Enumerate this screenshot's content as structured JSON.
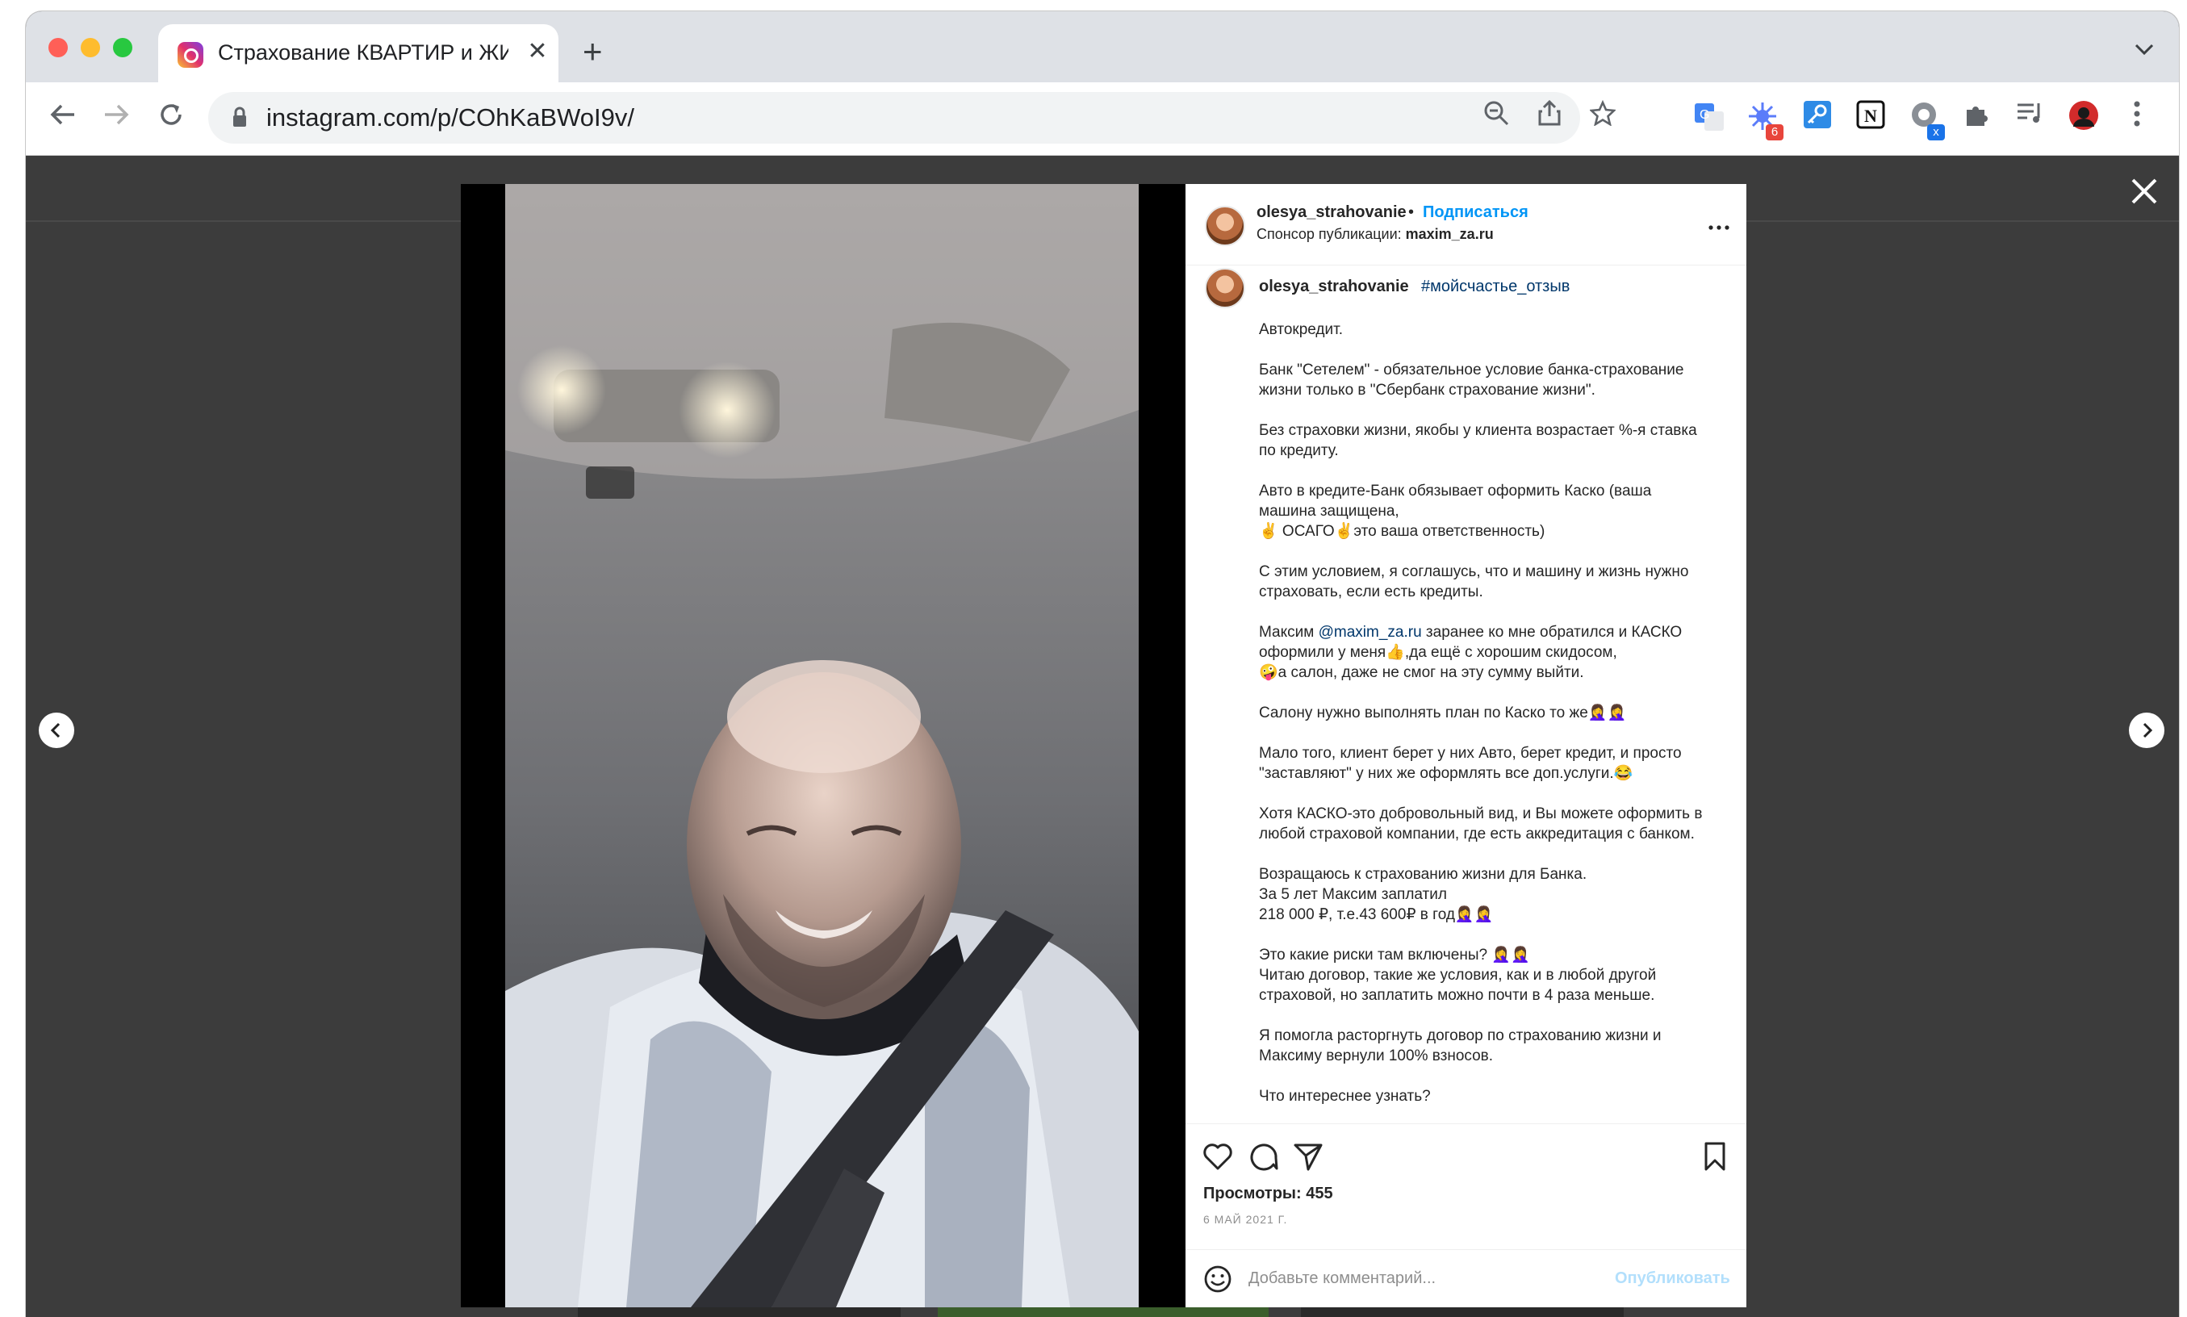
{
  "browser": {
    "tab_title": "Страхование КВАРТИР и ЖИЗНИ",
    "tab_close": "✕",
    "new_tab": "+",
    "url": "instagram.com/p/COhKaBWoI9v/",
    "extension_badge_1": "6",
    "extension_badge_2": "x"
  },
  "post": {
    "username": "olesya_strahovanie",
    "dot": "•",
    "follow_label": "Подписаться",
    "sponsor_prefix": "Спонсор публикации: ",
    "sponsor_name": "maxim_za.ru",
    "caption_user": "olesya_strahovanie",
    "caption_hashtag": "#мойсчастье_отзыв",
    "paragraphs": {
      "p1": "Автокредит.",
      "p2": "Банк \"Сетелем\" - обязательное условие банка-страхование\nжизни только в \"Сбербанк страхование жизни\".",
      "p3": "Без страховки жизни, якобы у клиента возрастает %-я ставка\nпо кредиту.",
      "p4": "Авто в кредите-Банк обязывает оформить Каско (ваша\nмашина защищена,\n✌️ ОСАГО✌️это ваша ответственность)",
      "p5": "С этим условием, я соглашусь, что и машину и жизнь нужно\nстраховать, если есть кредиты.",
      "p6_before": "Максим ",
      "p6_mention": "@maxim_za.ru",
      "p6_after": " заранее ко мне обратился и КАСКО\nоформили у меня👍,да ещё с хорошим скидосом,\n🤪а салон, даже не смог на эту сумму выйти.",
      "p7": "Салону нужно выполнять план по Каско то же🤦‍♀️🤦‍♀️",
      "p8": "Мало того, клиент берет у них Авто, берет кредит, и просто\n\"заставляют\" у них же оформлять все доп.услуги.😂",
      "p9": "Хотя КАСКО-это добровольный вид, и Вы можете оформить в\nлюбой страховой компании, где есть аккредитация с банком.",
      "p10": "Возращаюсь к страхованию жизни для Банка.\nЗа 5 лет Максим заплатил\n218 000 ₽, т.е.43 600₽ в год🤦‍♀️🤦‍♀️",
      "p11": "Это какие риски там включены? 🤦‍♀️🤦‍♀️\nЧитаю договор, такие же условия, как и в любой другой\nстраховой, но заплатить можно почти в 4 раза меньше.",
      "p12": "Я помогла расторгнуть договор по страхованию жизни и\nМаксиму вернули 100% взносов.",
      "p13": "Что интереснее узнать?"
    },
    "views_label": "Просмотры: 455",
    "date": "6 МАЙ 2021 Г.",
    "comment_placeholder": "Добавьте комментарий...",
    "publish_label": "Опубликовать"
  },
  "colors": {
    "link_blue": "#0095f6",
    "mention_blue": "#00376b",
    "overlay": "#3c3c3c"
  },
  "icons": [
    "instagram-favicon",
    "back-arrow-icon",
    "forward-arrow-icon",
    "reload-icon",
    "lock-icon",
    "zoom-out-icon",
    "share-icon",
    "bookmark-star-icon",
    "translate-icon",
    "extension-icon",
    "puzzle-icon",
    "media-control-icon",
    "profile-icon",
    "menu-dots-icon",
    "heart-icon",
    "comment-icon",
    "share-send-icon",
    "save-icon",
    "emoji-icon",
    "close-icon",
    "chevron-left-icon",
    "chevron-right-icon"
  ]
}
